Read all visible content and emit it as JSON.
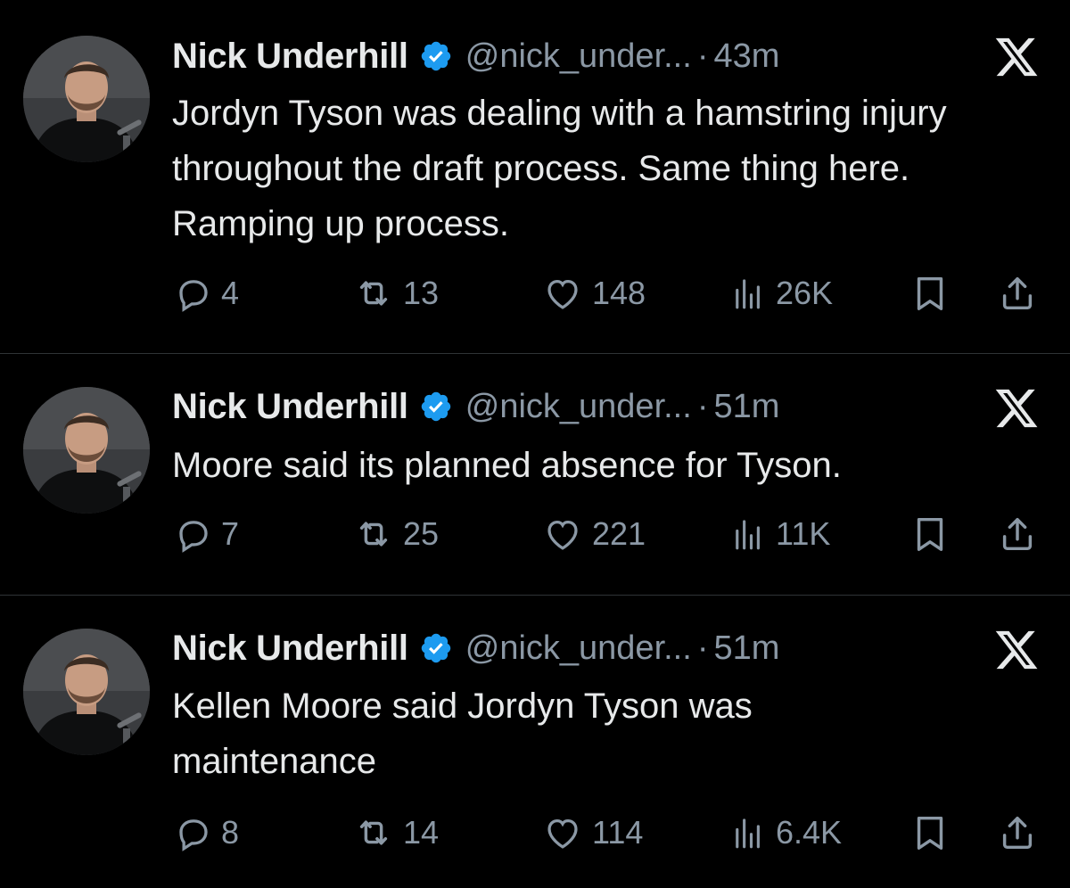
{
  "colors": {
    "background": "#000000",
    "text_primary": "#e7e9ea",
    "text_secondary": "#8b98a5",
    "verified_blue": "#1d9bf0",
    "divider": "#2f3336"
  },
  "icons": {
    "reply": "reply-icon",
    "retweet": "retweet-icon",
    "like": "heart-icon",
    "views": "views-chart-icon",
    "bookmark": "bookmark-icon",
    "share": "share-icon",
    "verified": "verified-badge-icon",
    "platform": "x-logo-icon"
  },
  "tweets": [
    {
      "author": {
        "display_name": "Nick Underhill",
        "handle": "@nick_under...",
        "verified": true
      },
      "separator": "·",
      "time": "43m",
      "text": "Jordyn Tyson was dealing with a hamstring injury throughout the draft process. Same thing here. Ramping up process.",
      "stats": {
        "replies": "4",
        "reposts": "13",
        "likes": "148",
        "views": "26K"
      }
    },
    {
      "author": {
        "display_name": "Nick Underhill",
        "handle": "@nick_under...",
        "verified": true
      },
      "separator": "·",
      "time": "51m",
      "text": "Moore said its planned absence for Tyson.",
      "stats": {
        "replies": "7",
        "reposts": "25",
        "likes": "221",
        "views": "11K"
      }
    },
    {
      "author": {
        "display_name": "Nick Underhill",
        "handle": "@nick_under...",
        "verified": true
      },
      "separator": "·",
      "time": "51m",
      "text": "Kellen Moore said Jordyn Tyson was maintenance",
      "stats": {
        "replies": "8",
        "reposts": "14",
        "likes": "114",
        "views": "6.4K"
      }
    }
  ]
}
